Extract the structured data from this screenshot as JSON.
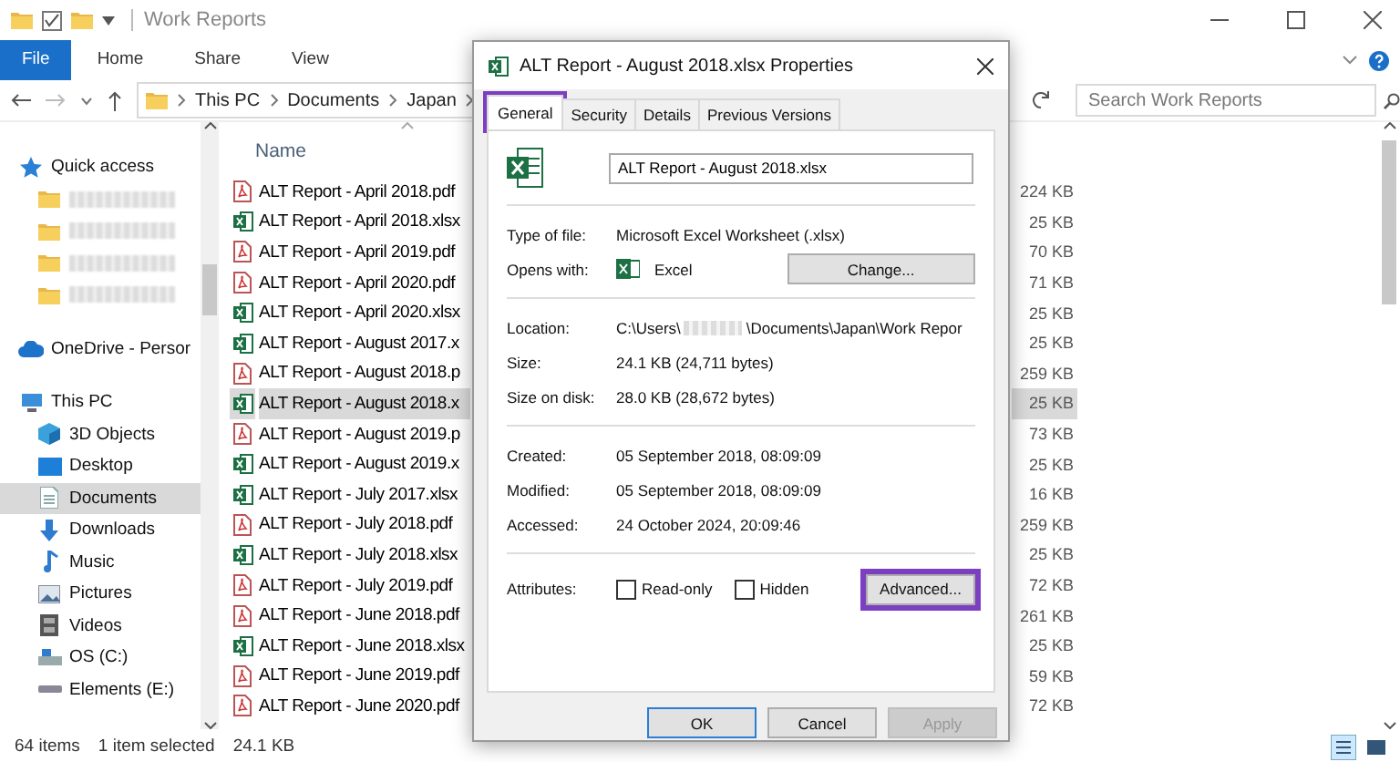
{
  "explorer": {
    "title": "Work Reports",
    "ribbon_tabs": [
      {
        "label": "File",
        "selected": true
      },
      {
        "label": "Home",
        "selected": false
      },
      {
        "label": "Share",
        "selected": false
      },
      {
        "label": "View",
        "selected": false
      }
    ],
    "breadcrumb": [
      "This PC",
      "Documents",
      "Japan"
    ],
    "search": {
      "placeholder": "Search Work Reports"
    },
    "sidebar": [
      {
        "kind": "star",
        "label": "Quick access",
        "selected": false,
        "children": [
          {
            "kind": "folder",
            "redacted": true,
            "selected": false
          },
          {
            "kind": "folder",
            "redacted": true,
            "selected": false
          },
          {
            "kind": "folder",
            "redacted": true,
            "selected": false
          },
          {
            "kind": "folder",
            "redacted": true,
            "selected": false
          }
        ]
      },
      {
        "kind": "cloud",
        "label": "OneDrive - Persor",
        "selected": false
      },
      {
        "kind": "pc",
        "label": "This PC",
        "selected": false,
        "children": [
          {
            "kind": "cube",
            "label": "3D Objects",
            "selected": false
          },
          {
            "kind": "desktop",
            "label": "Desktop",
            "selected": false
          },
          {
            "kind": "docs",
            "label": "Documents",
            "selected": true
          },
          {
            "kind": "download",
            "label": "Downloads",
            "selected": false
          },
          {
            "kind": "music",
            "label": "Music",
            "selected": false
          },
          {
            "kind": "pictures",
            "label": "Pictures",
            "selected": false
          },
          {
            "kind": "videos",
            "label": "Videos",
            "selected": false
          },
          {
            "kind": "drive",
            "label": "OS (C:)",
            "selected": false
          },
          {
            "kind": "extdrive",
            "label": "Elements (E:)",
            "selected": false
          }
        ]
      }
    ],
    "column_header": "Name",
    "files": [
      {
        "kind": "pdf",
        "name": "ALT Report - April 2018.pdf",
        "size": "224 KB",
        "selected": false
      },
      {
        "kind": "xlsx",
        "name": "ALT Report - April 2018.xlsx",
        "size": "25 KB",
        "selected": false
      },
      {
        "kind": "pdf",
        "name": "ALT Report - April 2019.pdf",
        "size": "70 KB",
        "selected": false
      },
      {
        "kind": "pdf",
        "name": "ALT Report - April 2020.pdf",
        "size": "71 KB",
        "selected": false
      },
      {
        "kind": "xlsx",
        "name": "ALT Report - April 2020.xlsx",
        "size": "25 KB",
        "selected": false
      },
      {
        "kind": "xlsx",
        "name": "ALT Report - August 2017.x",
        "size": "25 KB",
        "selected": false
      },
      {
        "kind": "pdf",
        "name": "ALT Report - August 2018.p",
        "size": "259 KB",
        "selected": false
      },
      {
        "kind": "xlsx",
        "name": "ALT Report - August 2018.x",
        "size": "25 KB",
        "selected": true
      },
      {
        "kind": "pdf",
        "name": "ALT Report - August 2019.p",
        "size": "73 KB",
        "selected": false
      },
      {
        "kind": "xlsx",
        "name": "ALT Report - August 2019.x",
        "size": "25 KB",
        "selected": false
      },
      {
        "kind": "xlsx",
        "name": "ALT Report - July 2017.xlsx",
        "size": "16 KB",
        "selected": false
      },
      {
        "kind": "pdf",
        "name": "ALT Report - July 2018.pdf",
        "size": "259 KB",
        "selected": false
      },
      {
        "kind": "xlsx",
        "name": "ALT Report - July 2018.xlsx",
        "size": "25 KB",
        "selected": false
      },
      {
        "kind": "pdf",
        "name": "ALT Report - July 2019.pdf",
        "size": "72 KB",
        "selected": false
      },
      {
        "kind": "pdf",
        "name": "ALT Report - June 2018.pdf",
        "size": "261 KB",
        "selected": false
      },
      {
        "kind": "xlsx",
        "name": "ALT Report - June 2018.xlsx",
        "size": "25 KB",
        "selected": false
      },
      {
        "kind": "pdf",
        "name": "ALT Report - June 2019.pdf",
        "size": "59 KB",
        "selected": false
      },
      {
        "kind": "pdf",
        "name": "ALT Report - June 2020.pdf",
        "size": "72 KB",
        "selected": false
      }
    ],
    "status_bar": {
      "count": "64 items",
      "selection": "1 item selected",
      "size": "24.1 KB"
    }
  },
  "dialog": {
    "title": "ALT Report - August 2018.xlsx Properties",
    "tabs": [
      {
        "label": "General",
        "selected": true,
        "highlighted": true
      },
      {
        "label": "Security",
        "selected": false,
        "highlighted": false
      },
      {
        "label": "Details",
        "selected": false,
        "highlighted": false
      },
      {
        "label": "Previous Versions",
        "selected": false,
        "highlighted": false
      }
    ],
    "file_name": "ALT Report - August 2018.xlsx",
    "sections": [
      [
        {
          "kind": "text",
          "label": "Type of file:",
          "value": "Microsoft Excel Worksheet (.xlsx)"
        },
        {
          "kind": "app",
          "label": "Opens with:",
          "value": "Excel",
          "button": "Change..."
        }
      ],
      [
        {
          "kind": "path",
          "label": "Location:",
          "value_start": "C:\\Users\\",
          "value_end": "\\Documents\\Japan\\Work Repor"
        },
        {
          "kind": "text",
          "label": "Size:",
          "value": "24.1 KB (24,711 bytes)"
        },
        {
          "kind": "text",
          "label": "Size on disk:",
          "value": "28.0 KB (28,672 bytes)"
        }
      ],
      [
        {
          "kind": "text",
          "label": "Created:",
          "value": "05 September 2018, 08:09:09"
        },
        {
          "kind": "text",
          "label": "Modified:",
          "value": "05 September 2018, 08:09:09"
        },
        {
          "kind": "text",
          "label": "Accessed:",
          "value": "24 October 2024, 20:09:46"
        }
      ]
    ],
    "attributes": {
      "label": "Attributes:",
      "options": [
        {
          "label": "Read-only",
          "checked": false
        },
        {
          "label": "Hidden",
          "checked": false
        }
      ],
      "button": {
        "label": "Advanced...",
        "highlighted": true
      }
    },
    "buttons": [
      {
        "label": "OK",
        "default": true,
        "disabled": false
      },
      {
        "label": "Cancel",
        "default": false,
        "disabled": false
      },
      {
        "label": "Apply",
        "default": false,
        "disabled": true
      }
    ]
  }
}
